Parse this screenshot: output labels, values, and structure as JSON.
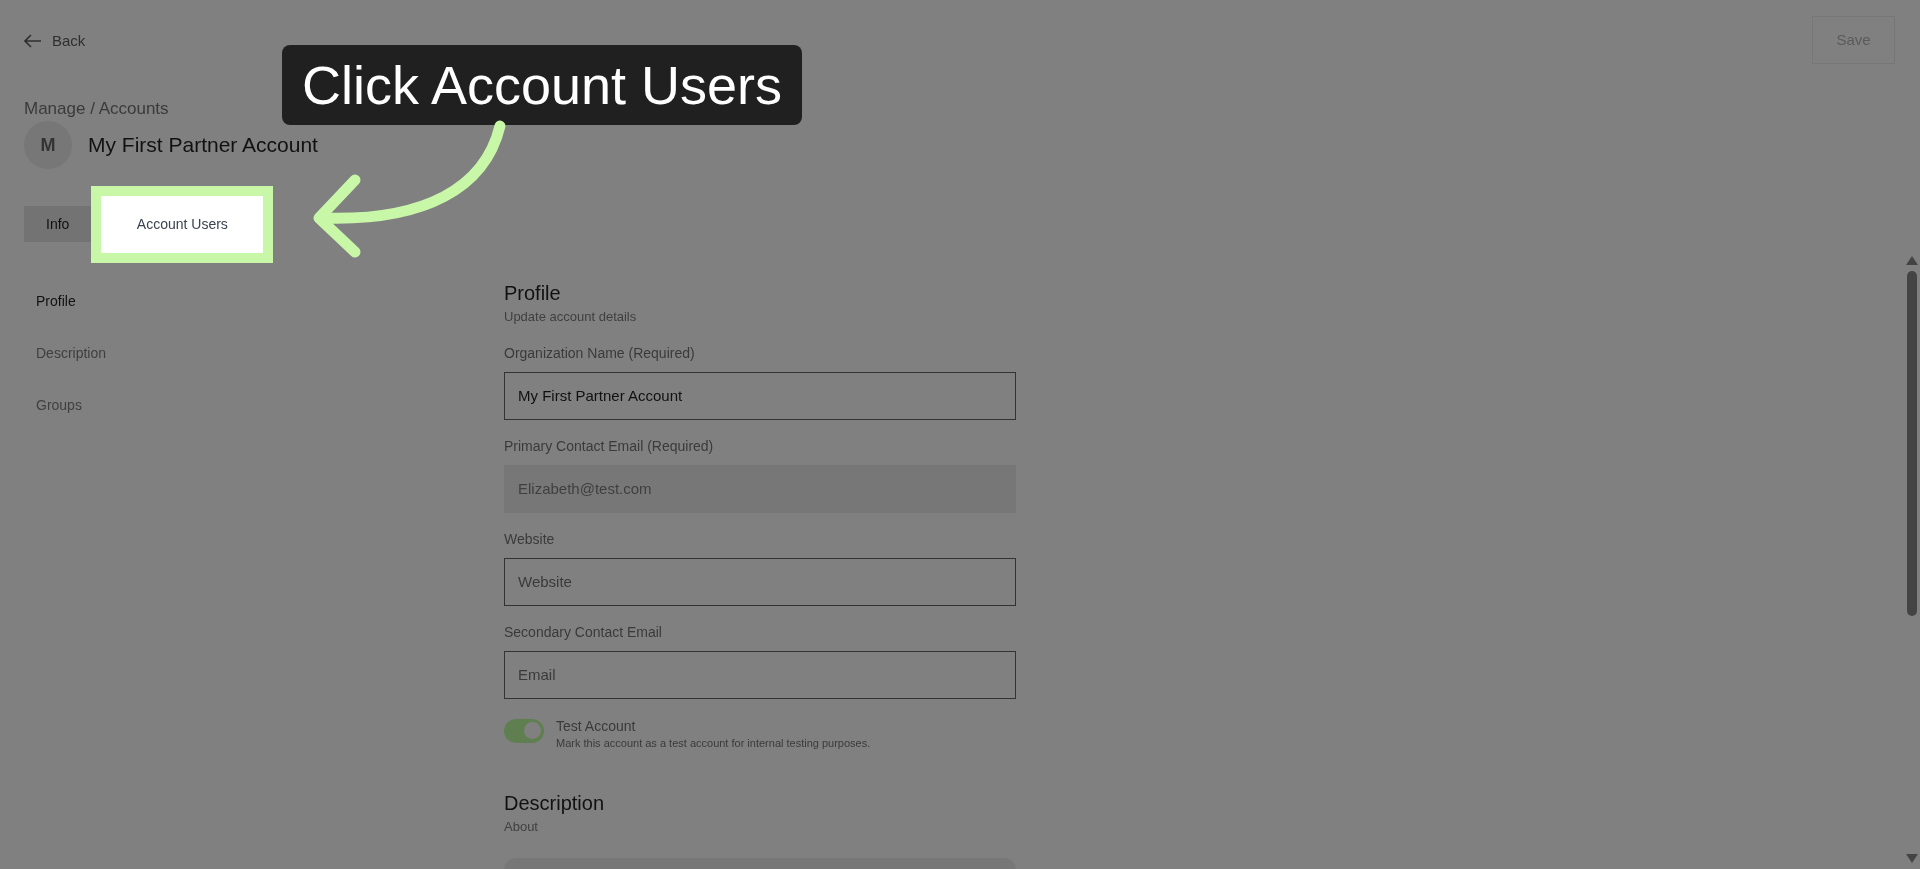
{
  "header": {
    "back": "Back",
    "save": {
      "label": "Save",
      "disabled": true
    }
  },
  "breadcrumb": "Manage / Accounts",
  "account": {
    "avatar": "M",
    "name": "My First Partner Account"
  },
  "tabs": [
    {
      "label": "Info",
      "selected": true
    },
    {
      "label": "Account Users",
      "selected": false,
      "highlighted": true
    }
  ],
  "callout": {
    "text": "Click Account Users"
  },
  "nav": [
    {
      "label": "Profile",
      "selected": true
    },
    {
      "label": "Description",
      "selected": false
    },
    {
      "label": "Groups",
      "selected": false
    }
  ],
  "profile": {
    "title": "Profile",
    "subtitle": "Update account details",
    "fields": [
      {
        "label": "Organization Name (Required)",
        "value": "My First Partner Account",
        "disabled": false
      },
      {
        "label": "Primary Contact Email (Required)",
        "value": "Elizabeth@test.com",
        "disabled": true
      },
      {
        "label": "Website",
        "placeholder": "Website",
        "disabled": false
      },
      {
        "label": "Secondary Contact Email",
        "placeholder": "Email",
        "disabled": false
      }
    ],
    "toggle": {
      "label": "Test Account",
      "description": "Mark this account as a test account for internal testing purposes.",
      "on": true
    }
  },
  "description": {
    "title": "Description",
    "subtitle": "About"
  }
}
